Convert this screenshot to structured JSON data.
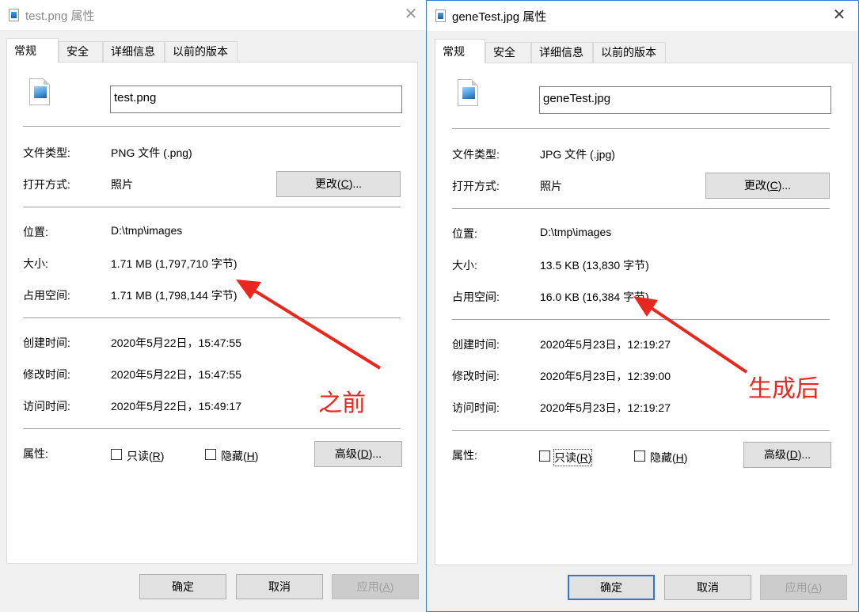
{
  "left": {
    "title": "test.png 属性",
    "close": "✕",
    "tabs": [
      "常规",
      "安全",
      "详细信息",
      "以前的版本"
    ],
    "filename": "test.png",
    "rows": {
      "type_label": "文件类型:",
      "type_value": "PNG 文件 (.png)",
      "open_label": "打开方式:",
      "open_value": "照片",
      "location_label": "位置:",
      "location_value": "D:\\tmp\\images",
      "size_label": "大小:",
      "size_value": "1.71 MB (1,797,710 字节)",
      "disk_label": "占用空间:",
      "disk_value": "1.71 MB (1,798,144 字节)",
      "created_label": "创建时间:",
      "created_value": "2020年5月22日，15:47:55",
      "modified_label": "修改时间:",
      "modified_value": "2020年5月22日，15:47:55",
      "accessed_label": "访问时间:",
      "accessed_value": "2020年5月22日，15:49:17",
      "attr_label": "属性:"
    },
    "change_button": {
      "text": "更改(",
      "key": "C",
      "tail": ")..."
    },
    "readonly": {
      "text": "只读(",
      "key": "R",
      "tail": ")"
    },
    "hidden": {
      "text": "隐藏(",
      "key": "H",
      "tail": ")"
    },
    "advanced_button": {
      "text": "高级(",
      "key": "D",
      "tail": ")..."
    },
    "ok": "确定",
    "cancel": "取消",
    "apply": {
      "text": "应用(",
      "key": "A",
      "tail": ")"
    }
  },
  "right": {
    "title": "geneTest.jpg 属性",
    "close": "✕",
    "tabs": [
      "常规",
      "安全",
      "详细信息",
      "以前的版本"
    ],
    "filename": "geneTest.jpg",
    "rows": {
      "type_label": "文件类型:",
      "type_value": "JPG 文件 (.jpg)",
      "open_label": "打开方式:",
      "open_value": "照片",
      "location_label": "位置:",
      "location_value": "D:\\tmp\\images",
      "size_label": "大小:",
      "size_value": "13.5 KB (13,830 字节)",
      "disk_label": "占用空间:",
      "disk_value": "16.0 KB (16,384 字节)",
      "created_label": "创建时间:",
      "created_value": "2020年5月23日，12:19:27",
      "modified_label": "修改时间:",
      "modified_value": "2020年5月23日，12:39:00",
      "accessed_label": "访问时间:",
      "accessed_value": "2020年5月23日，12:19:27",
      "attr_label": "属性:"
    },
    "change_button": {
      "text": "更改(",
      "key": "C",
      "tail": ")..."
    },
    "readonly": {
      "text": "只读(",
      "key": "R",
      "tail": ")"
    },
    "hidden": {
      "text": "隐藏(",
      "key": "H",
      "tail": ")"
    },
    "advanced_button": {
      "text": "高级(",
      "key": "D",
      "tail": ")..."
    },
    "ok": "确定",
    "cancel": "取消",
    "apply": {
      "text": "应用(",
      "key": "A",
      "tail": ")"
    }
  },
  "annotations": {
    "before": "之前",
    "after": "生成后",
    "color": "#e8281e"
  },
  "icons": {
    "file": "image-file-icon",
    "close": "close-icon"
  }
}
